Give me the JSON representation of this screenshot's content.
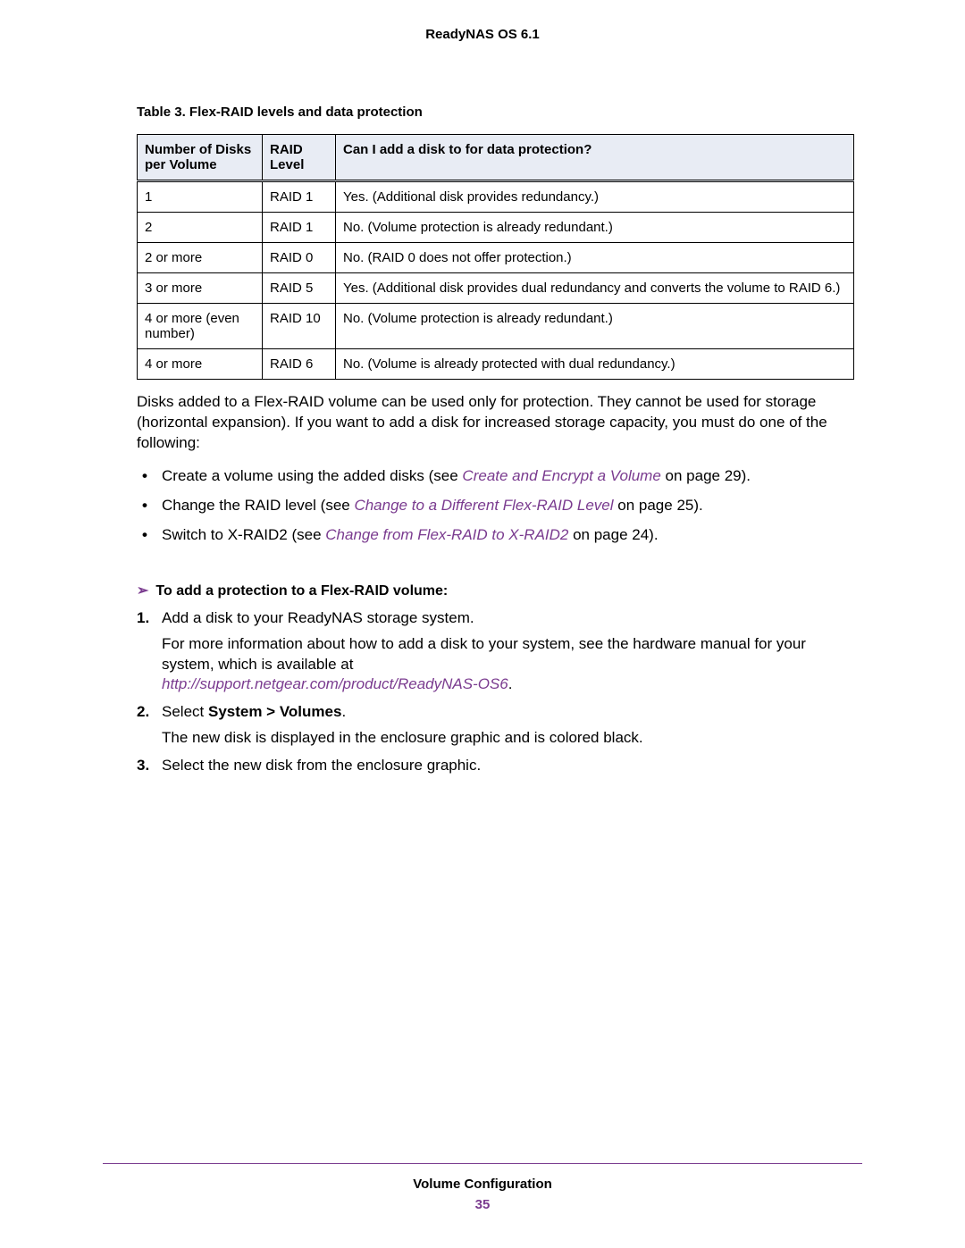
{
  "header": {
    "title": "ReadyNAS OS 6.1"
  },
  "table": {
    "caption": "Table 3.  Flex-RAID levels and data protection",
    "headers": {
      "col1": "Number of Disks per Volume",
      "col2": "RAID Level",
      "col3": "Can I add a disk to for data protection?"
    },
    "rows": [
      {
        "disks": "1",
        "raid": "RAID 1",
        "desc": "Yes. (Additional disk provides redundancy.)"
      },
      {
        "disks": "2",
        "raid": "RAID 1",
        "desc": "No. (Volume protection is already redundant.)"
      },
      {
        "disks": "2 or more",
        "raid": "RAID 0",
        "desc": "No. (RAID 0 does not offer protection.)"
      },
      {
        "disks": "3 or more",
        "raid": "RAID 5",
        "desc": "Yes. (Additional disk provides dual redundancy and converts the volume to RAID 6.)"
      },
      {
        "disks": "4 or more (even number)",
        "raid": "RAID 10",
        "desc": "No. (Volume protection is already redundant.)"
      },
      {
        "disks": "4 or more",
        "raid": "RAID 6",
        "desc": "No. (Volume is already protected with dual redundancy.)"
      }
    ]
  },
  "paragraph1": "Disks added to a Flex-RAID volume can be used only for protection. They cannot be used for storage (horizontal expansion). If you want to add a disk for increased storage capacity, you must do one of the following:",
  "bullets": [
    {
      "pre": "Create a volume using the added disks (see ",
      "link": "Create and Encrypt a Volume",
      "post": " on page 29)."
    },
    {
      "pre": "Change the RAID level (see ",
      "link": "Change to a Different Flex-RAID Level",
      "post": " on page 25)."
    },
    {
      "pre": "Switch to X-RAID2 (see ",
      "link": "Change from Flex-RAID to X-RAID2",
      "post": " on page 24)."
    }
  ],
  "procedure": {
    "arrow": "➢",
    "heading": "To add a protection to a Flex-RAID volume:",
    "steps": {
      "s1": {
        "num": "1.",
        "text": "Add a disk to your ReadyNAS storage system.",
        "sub1": "For more information about how to add a disk to your system, see the hardware manual for your system, which is available at",
        "url": "http://support.netgear.com/product/ReadyNAS-OS6",
        "period": "."
      },
      "s2": {
        "num": "2.",
        "pre": "Select ",
        "bold": "System > Volumes",
        "post": ".",
        "sub": "The new disk is displayed in the enclosure graphic and is colored black."
      },
      "s3": {
        "num": "3.",
        "text": "Select the new disk from the enclosure graphic."
      }
    }
  },
  "footer": {
    "title": "Volume Configuration",
    "page": "35"
  }
}
